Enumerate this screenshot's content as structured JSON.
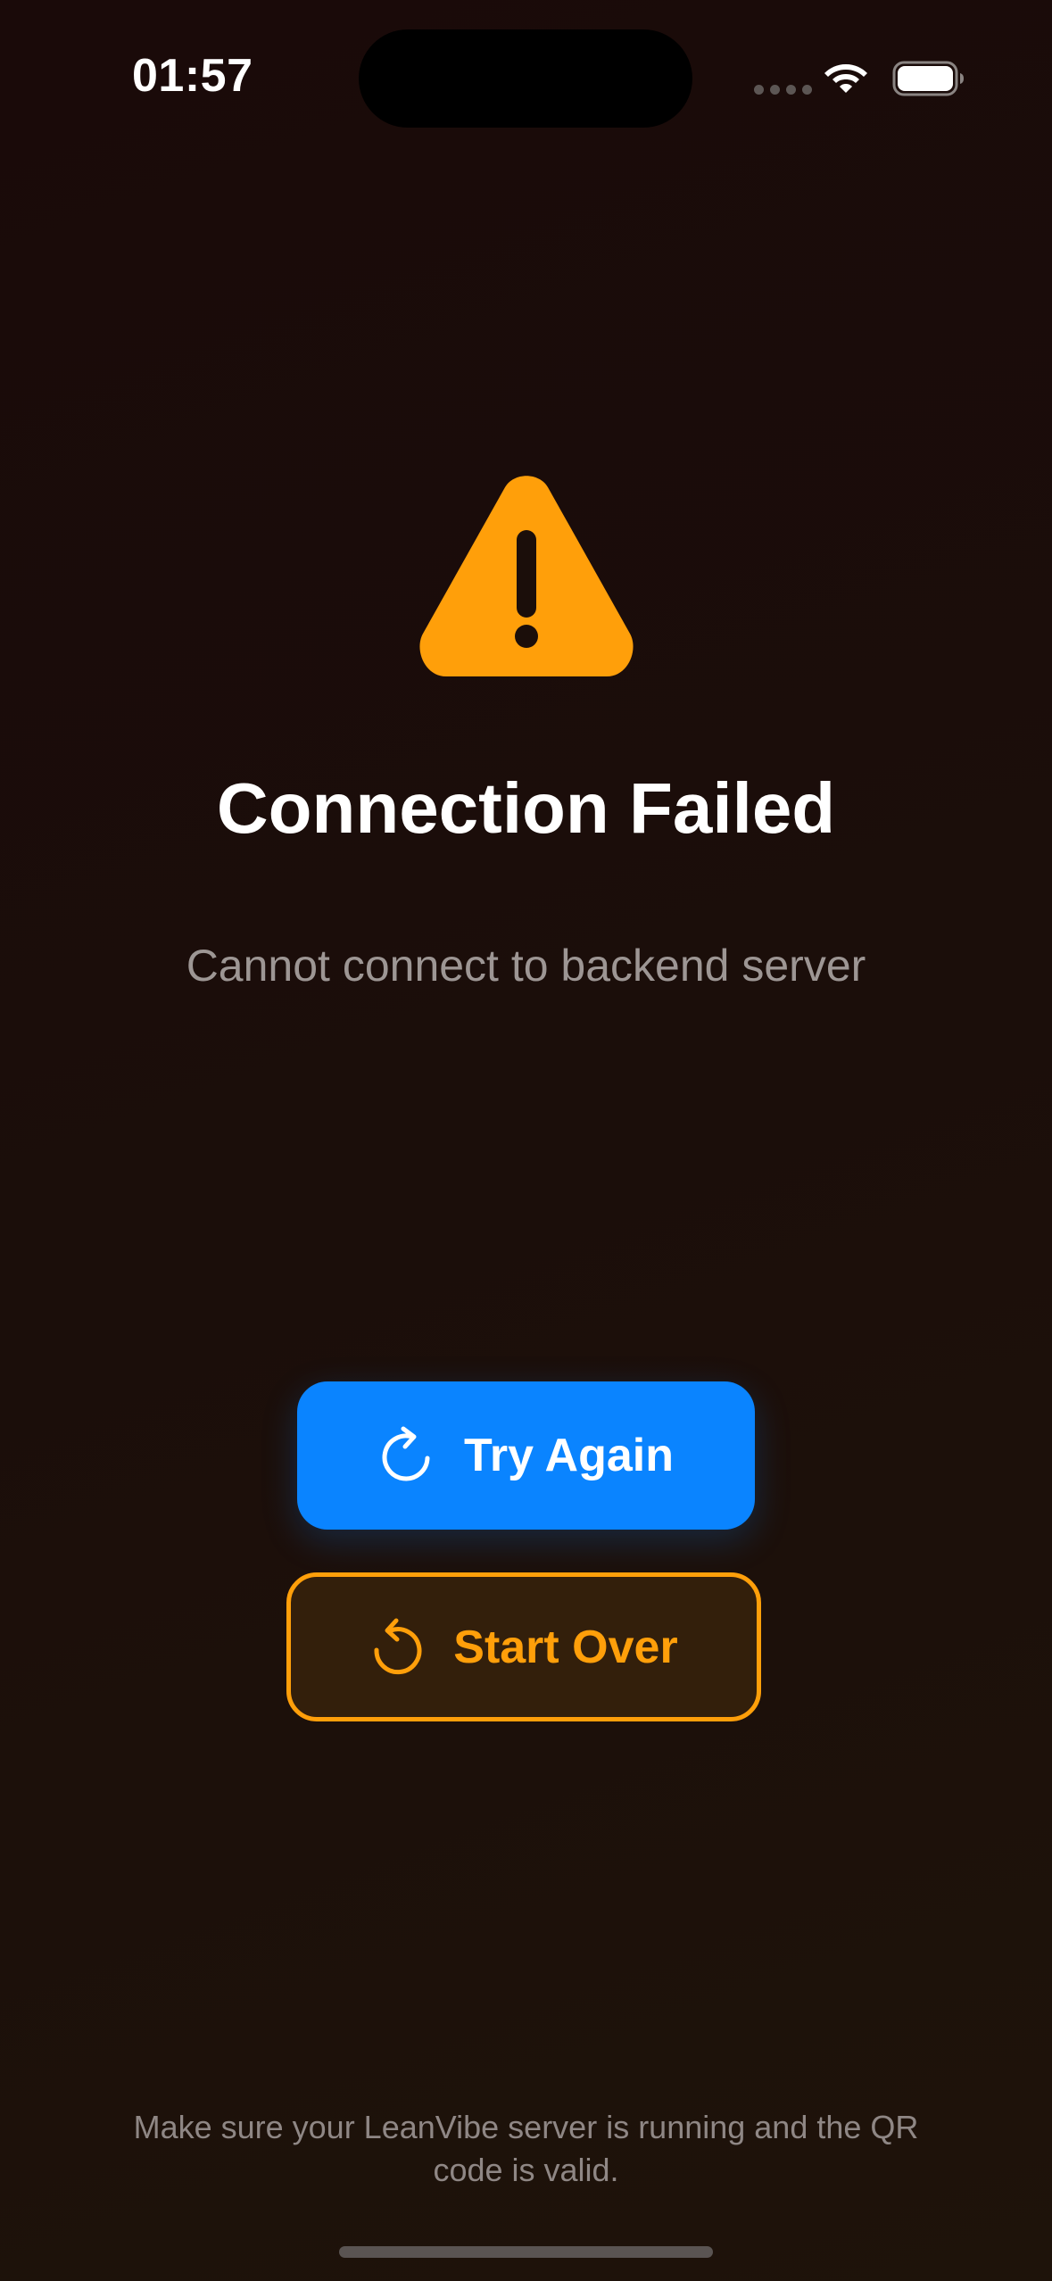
{
  "status_bar": {
    "time": "01:57",
    "icons": [
      "cellular-signal-icon",
      "wifi-icon",
      "battery-icon"
    ]
  },
  "error": {
    "icon": "warning-triangle-icon",
    "title": "Connection Failed",
    "message": "Cannot connect to backend server"
  },
  "actions": {
    "try_again": {
      "label": "Try Again",
      "icon": "refresh-icon"
    },
    "start_over": {
      "label": "Start Over",
      "icon": "rotate-left-icon"
    }
  },
  "footer": {
    "note": "Make sure your LeanVibe server is running and the QR code is valid."
  },
  "colors": {
    "background": "#1b0e0a",
    "warning": "#ff9f0a",
    "primary": "#0a84ff",
    "text_secondary": "#9d9694"
  }
}
